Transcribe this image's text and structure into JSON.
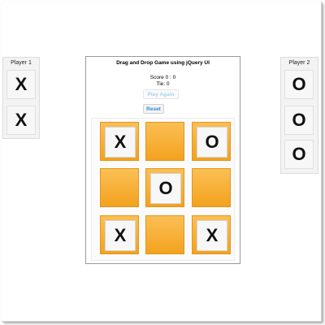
{
  "player1": {
    "title": "Player 1",
    "pieces": [
      "X",
      "X"
    ]
  },
  "player2": {
    "title": "Player 2",
    "pieces": [
      "O",
      "O",
      "O"
    ]
  },
  "game": {
    "title": "Drag and Drop Game using jQuery UI",
    "score_label": "Score 0 : 0",
    "tie_label": "Tie: 0",
    "play_again_label": "Play Again",
    "reset_label": "Reset"
  },
  "board": {
    "cells": [
      "X",
      "",
      "O",
      "",
      "O",
      "",
      "X",
      "",
      "X"
    ]
  },
  "colors": {
    "cell": "#f3a21f",
    "link": "#2b8bd0"
  }
}
